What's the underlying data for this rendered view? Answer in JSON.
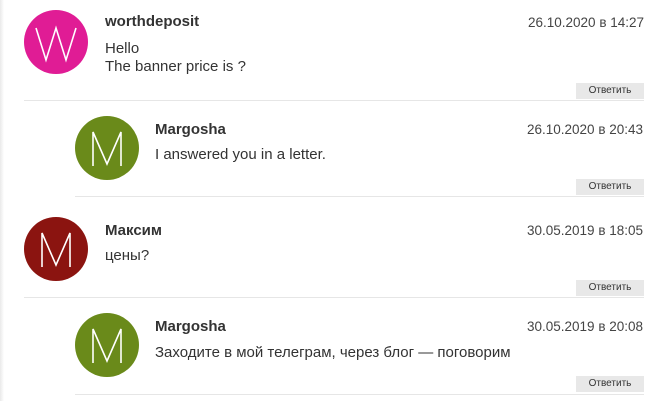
{
  "comments": [
    {
      "author": "worthdeposit",
      "date": "26.10.2020 в 14:27",
      "lines": [
        "Hello",
        "The banner price is ?"
      ],
      "reply_label": "Ответить",
      "avatar": {
        "letter": "W",
        "color": "#e01c95"
      }
    },
    {
      "author": "Margosha",
      "date": "26.10.2020 в 20:43",
      "lines": [
        "I answered you in a letter."
      ],
      "reply_label": "Ответить",
      "avatar": {
        "letter": "M",
        "color": "#6a8a1a"
      }
    },
    {
      "author": "Максим",
      "date": "30.05.2019 в 18:05",
      "lines": [
        "цены?"
      ],
      "reply_label": "Ответить",
      "avatar": {
        "letter": "M",
        "color": "#8b1410"
      }
    },
    {
      "author": "Margosha",
      "date": "30.05.2019 в 20:08",
      "lines": [
        "Заходите в мой телеграм, через блог — поговорим"
      ],
      "reply_label": "Ответить",
      "avatar": {
        "letter": "M",
        "color": "#6a8a1a"
      }
    }
  ]
}
